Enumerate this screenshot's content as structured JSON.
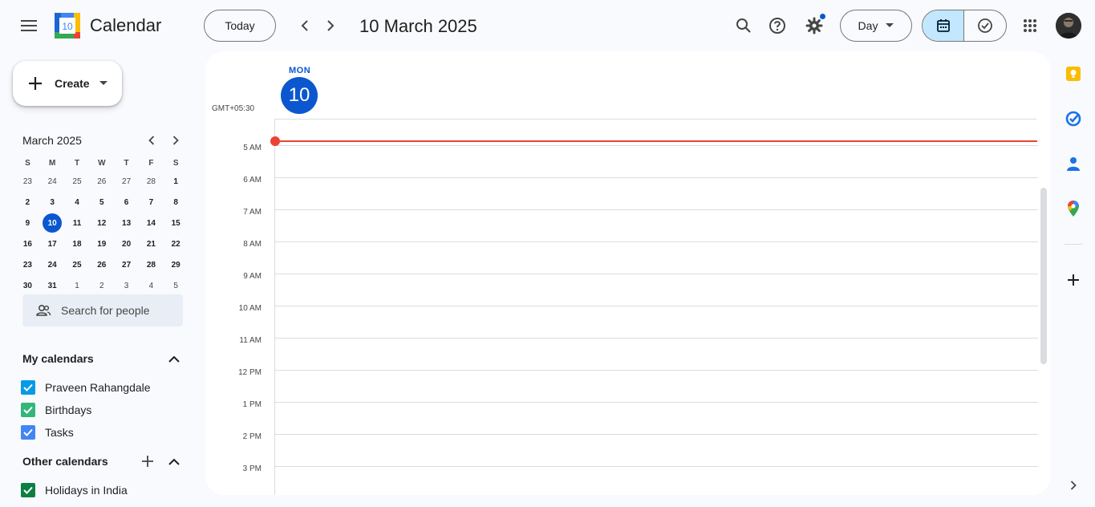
{
  "header": {
    "app_title": "Calendar",
    "logo_day": "10",
    "today_label": "Today",
    "date_title": "10 March 2025",
    "view_label": "Day"
  },
  "sidebar": {
    "create_label": "Create",
    "mini_calendar": {
      "title": "March 2025",
      "weekdays": [
        "S",
        "M",
        "T",
        "W",
        "T",
        "F",
        "S"
      ],
      "weeks": [
        [
          "23",
          "24",
          "25",
          "26",
          "27",
          "28",
          "1"
        ],
        [
          "2",
          "3",
          "4",
          "5",
          "6",
          "7",
          "8"
        ],
        [
          "9",
          "10",
          "11",
          "12",
          "13",
          "14",
          "15"
        ],
        [
          "16",
          "17",
          "18",
          "19",
          "20",
          "21",
          "22"
        ],
        [
          "23",
          "24",
          "25",
          "26",
          "27",
          "28",
          "29"
        ],
        [
          "30",
          "31",
          "1",
          "2",
          "3",
          "4",
          "5"
        ]
      ],
      "selected": "10"
    },
    "search_people_placeholder": "Search for people",
    "my_calendars_title": "My calendars",
    "my_calendars": [
      {
        "label": "Praveen Rahangdale",
        "color": "#039be5"
      },
      {
        "label": "Birthdays",
        "color": "#33b679"
      },
      {
        "label": "Tasks",
        "color": "#4285f4"
      }
    ],
    "other_calendars_title": "Other calendars",
    "other_calendars": [
      {
        "label": "Holidays in India",
        "color": "#0b8043"
      }
    ]
  },
  "main": {
    "day_of_week": "MON",
    "day_number": "10",
    "timezone": "GMT+05:30",
    "hours": [
      "5 AM",
      "6 AM",
      "7 AM",
      "8 AM",
      "9 AM",
      "10 AM",
      "11 AM",
      "12 PM",
      "1 PM",
      "2 PM",
      "3 PM"
    ]
  },
  "colors": {
    "accent": "#0b57d0",
    "now_line": "#ea4335",
    "selected_segment": "#c2e7ff"
  },
  "side_panel": {
    "icons": [
      "keep-icon",
      "tasks-icon",
      "contacts-icon",
      "maps-icon",
      "add-icon",
      "expand-icon"
    ]
  }
}
